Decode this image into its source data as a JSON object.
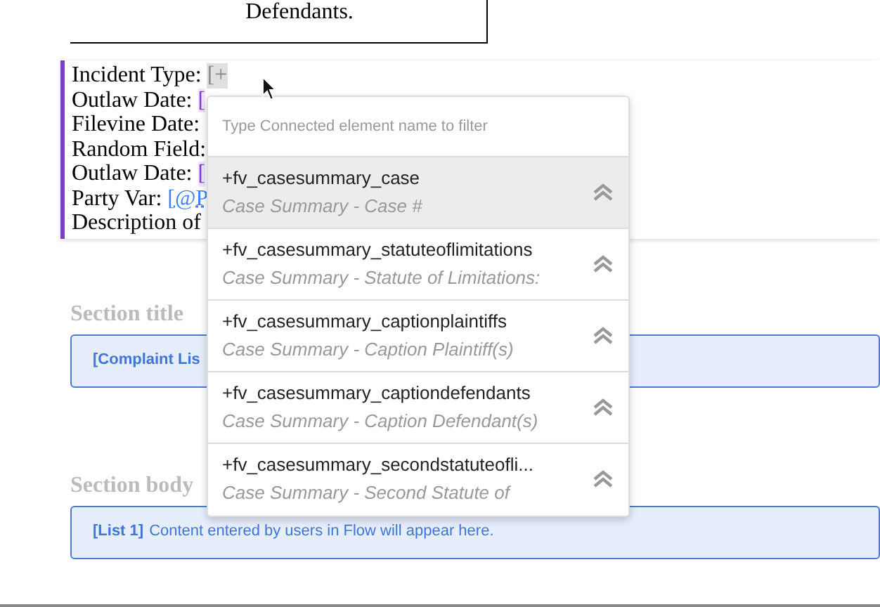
{
  "caption_box": {
    "text": "Defendants."
  },
  "editor_lines": [
    {
      "label": "Incident Type:",
      "token": "[+",
      "kind": "add"
    },
    {
      "label": "Outlaw Date:",
      "token": "[",
      "kind": "date"
    },
    {
      "label": "Filevine Date:",
      "kind": "plain"
    },
    {
      "label": "Random Field:",
      "kind": "plain"
    },
    {
      "label": "Outlaw Date:",
      "token": "[",
      "kind": "date"
    },
    {
      "label": "Party Var:",
      "token": "[@P",
      "kind": "party"
    },
    {
      "label": "Description of",
      "kind": "plain"
    }
  ],
  "dropdown": {
    "placeholder": "Type Connected element name to filter",
    "items": [
      {
        "name": "+fv_casesummary_case",
        "description": "Case Summary - Case #",
        "selected": true
      },
      {
        "name": "+fv_casesummary_statuteoflimitations",
        "description": "Case Summary - Statute of Limitations:",
        "selected": false
      },
      {
        "name": "+fv_casesummary_captionplaintiffs",
        "description": "Case Summary - Caption Plaintiff(s)",
        "selected": false
      },
      {
        "name": "+fv_casesummary_captiondefendants",
        "description": "Case Summary - Caption Defendant(s)",
        "selected": false
      },
      {
        "name": "+fv_casesummary_secondstatuteofli...",
        "description": "Case Summary - Second Statute of",
        "selected": false
      }
    ]
  },
  "sections": [
    {
      "title": "Section title",
      "tag": "[Complaint Lis"
    },
    {
      "title": "Section body",
      "tag": "[List 1]",
      "text": "Content entered by users in Flow will appear here."
    }
  ]
}
